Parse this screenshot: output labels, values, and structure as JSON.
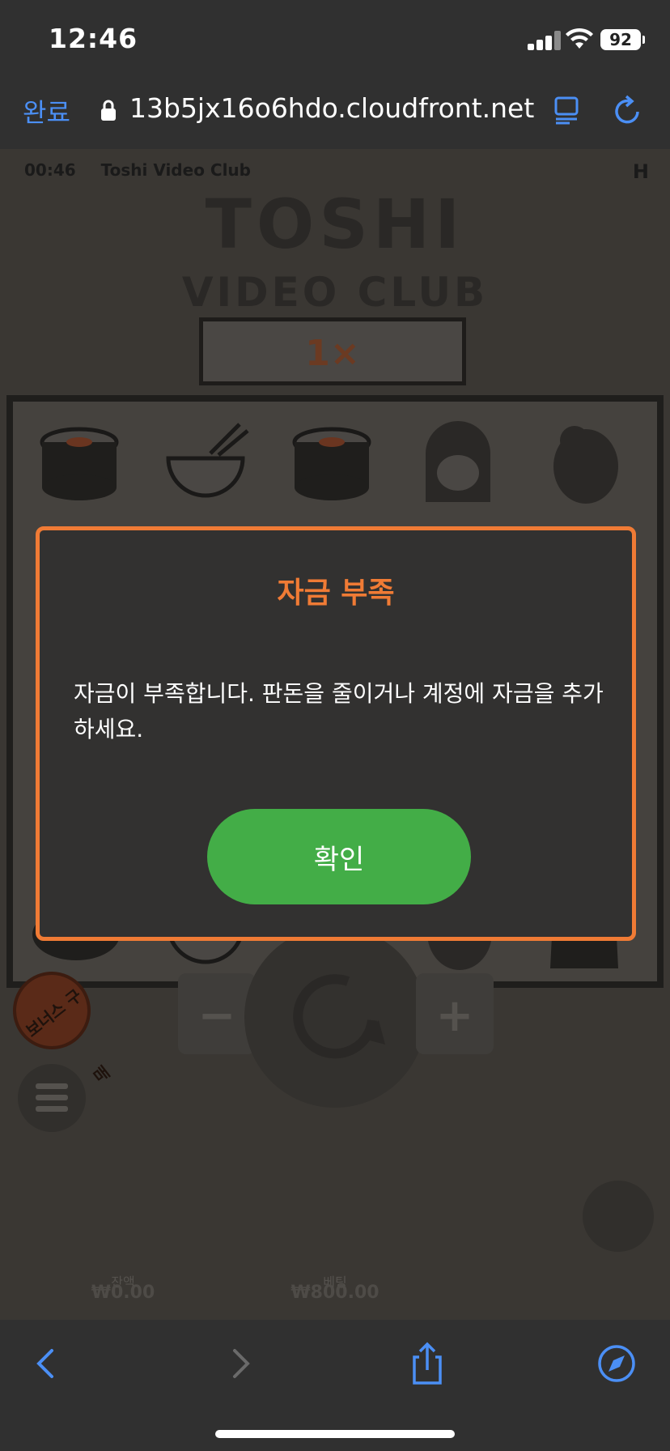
{
  "status_bar": {
    "time": "12:46",
    "battery": "92"
  },
  "url_bar": {
    "done_label": "완료",
    "url": "13b5jx16o6hdo.cloudfront.net"
  },
  "game": {
    "round_time": "00:46",
    "game_name": "Toshi Video Club",
    "logo_line1": "TOSHI",
    "logo_line2": "VIDEO CLUB",
    "multiplier": "1×",
    "bonus_buy_label": "보너스 구매",
    "minus_label": "−",
    "plus_label": "+",
    "balance_label": "잔액",
    "balance_value": "₩0.00",
    "bet_label": "베팅",
    "bet_value": "₩800.00"
  },
  "modal": {
    "title": "자금 부족",
    "message": "자금이 부족합니다. 판돈을 줄이거나 계정에 자금을 추가하세요.",
    "ok_label": "확인"
  },
  "toolbar": {
    "icons": [
      "back-icon",
      "forward-icon",
      "share-icon",
      "compass-icon"
    ]
  },
  "colors": {
    "accent_orange": "#f07b35",
    "ok_green": "#43ad47",
    "link_blue": "#4b8ff5"
  }
}
